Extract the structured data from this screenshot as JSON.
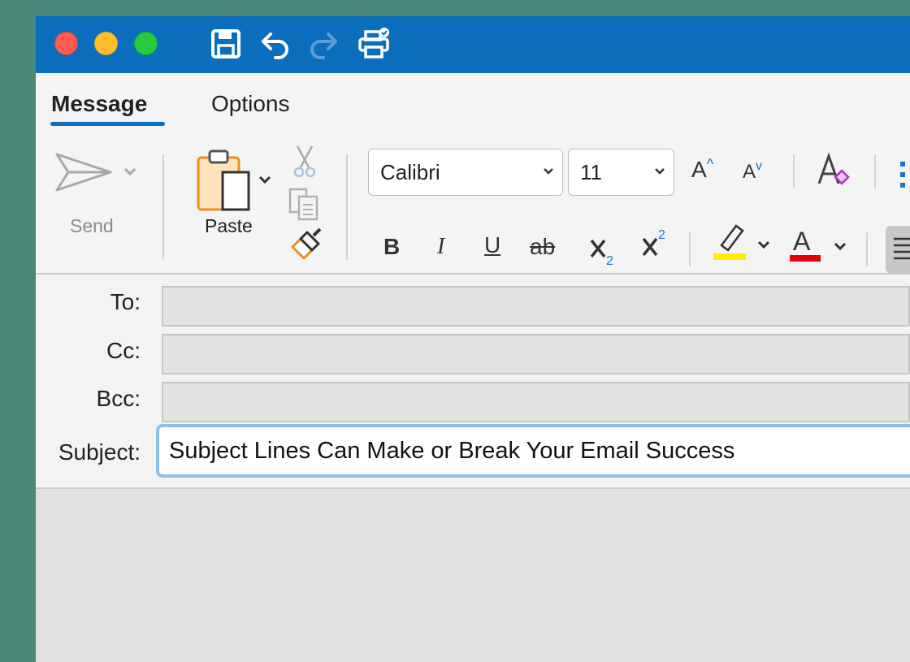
{
  "colors": {
    "desktop": "#4a8878",
    "titlebar": "#0a6ebd",
    "accent": "#0a6ebd",
    "highlight_yellow": "#ffea00",
    "font_color_red": "#e8000b"
  },
  "titlebar": {
    "icons": [
      "save-icon",
      "undo-icon",
      "redo-icon",
      "print-icon"
    ]
  },
  "tabs": [
    {
      "label": "Message",
      "active": true
    },
    {
      "label": "Options",
      "active": false
    }
  ],
  "ribbon": {
    "send_label": "Send",
    "paste_label": "Paste",
    "font_name": "Calibri",
    "font_size": "11",
    "bold": "B",
    "italic": "I",
    "underline": "U",
    "strikethrough": "ab",
    "grow_font": "A",
    "shrink_font": "A",
    "font_color_letter": "A"
  },
  "fields": {
    "to_label": "To:",
    "cc_label": "Cc:",
    "bcc_label": "Bcc:",
    "subject_label": "Subject:",
    "to_value": "",
    "cc_value": "",
    "bcc_value": "",
    "subject_value": "Subject Lines Can Make or Break Your Email Success"
  }
}
